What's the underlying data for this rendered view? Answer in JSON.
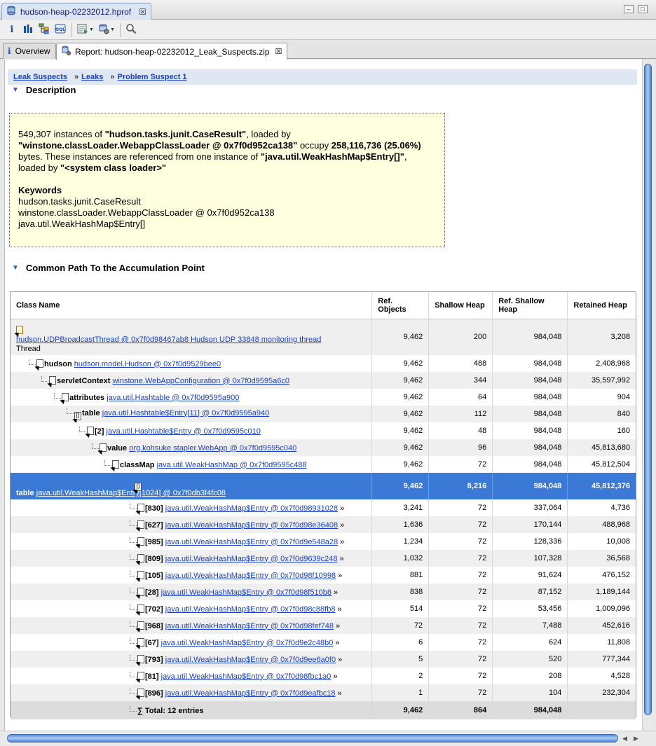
{
  "editor_tab": {
    "title": "hudson-heap-02232012.hprof"
  },
  "report_tabs": [
    {
      "label": "Overview"
    },
    {
      "label": "Report: hudson-heap-02232012_Leak_Suspects.zip"
    }
  ],
  "breadcrumb": [
    "Leak Suspects",
    "Leaks",
    "Problem Suspect 1"
  ],
  "breadcrumb_sep": "»",
  "description": {
    "title": "Description",
    "count": "549,307",
    "t1": " instances of ",
    "class_name": "\"hudson.tasks.junit.CaseResult\"",
    "t2": ", loaded by ",
    "loader": "\"winstone.classLoader.WebappClassLoader @ 0x7f0d952ca138\"",
    "t3": " occupy ",
    "size": "258,116,736 (25.06%)",
    "t4": " bytes. These instances are referenced from one instance of ",
    "ref_class": "\"java.util.WeakHashMap$Entry[]\"",
    "t5": ", loaded by ",
    "ref_loader": "\"<system class loader>\"",
    "keywords_title": "Keywords",
    "keywords": [
      "hudson.tasks.junit.CaseResult",
      "winstone.classLoader.WebappClassLoader @ 0x7f0d952ca138",
      "java.util.WeakHashMap$Entry[]"
    ]
  },
  "path_section": {
    "title": "Common Path To the Accumulation Point",
    "columns": {
      "name": "Class Name",
      "ref_objects": "Ref. Objects",
      "shallow": "Shallow Heap",
      "ref_shallow": "Ref. Shallow Heap",
      "retained": "Retained Heap"
    },
    "rows": [
      {
        "field": "",
        "link": "hudson.UDPBroadcastThread @ 0x7f0d98467ab8 Hudson UDP 33848 monitoring thread",
        "suffix": "Thread",
        "more": "",
        "ref": "9,462",
        "sh": "200",
        "rsh": "984,048",
        "ret": "3,208"
      },
      {
        "field": "hudson",
        "link": "hudson.model.Hudson @ 0x7f0d9529bee0",
        "suffix": "",
        "more": "",
        "ref": "9,462",
        "sh": "488",
        "rsh": "984,048",
        "ret": "2,408,968"
      },
      {
        "field": "servletContext",
        "link": "winstone.WebAppConfiguration @ 0x7f0d9595a6c0",
        "suffix": "",
        "more": "",
        "ref": "9,462",
        "sh": "344",
        "rsh": "984,048",
        "ret": "35,597,992"
      },
      {
        "field": "attributes",
        "link": "java.util.Hashtable @ 0x7f0d9595a900",
        "suffix": "",
        "more": "",
        "ref": "9,462",
        "sh": "64",
        "rsh": "984,048",
        "ret": "904"
      },
      {
        "field": "table",
        "link": "java.util.Hashtable$Entry[11] @ 0x7f0d9595a940",
        "suffix": "",
        "more": "",
        "ref": "9,462",
        "sh": "112",
        "rsh": "984,048",
        "ret": "840"
      },
      {
        "field": "[2]",
        "link": "java.util.Hashtable$Entry @ 0x7f0d9595c010",
        "suffix": "",
        "more": "",
        "ref": "9,462",
        "sh": "48",
        "rsh": "984,048",
        "ret": "160"
      },
      {
        "field": "value",
        "link": "org.kohsuke.stapler.WebApp @ 0x7f0d9595c040",
        "suffix": "",
        "more": "",
        "ref": "9,462",
        "sh": "96",
        "rsh": "984,048",
        "ret": "45,813,680"
      },
      {
        "field": "classMap",
        "link": "java.util.WeakHashMap @ 0x7f0d9595c488",
        "suffix": "",
        "more": "",
        "ref": "9,462",
        "sh": "72",
        "rsh": "984,048",
        "ret": "45,812,504"
      },
      {
        "field": "table",
        "link": "java.util.WeakHashMap$Entry[1024] @ 0x7f0db3f4fc08",
        "suffix": "",
        "more": "",
        "ref": "9,462",
        "sh": "8,216",
        "rsh": "984,048",
        "ret": "45,812,376"
      },
      {
        "field": "[830]",
        "link": "java.util.WeakHashMap$Entry @ 0x7f0d98931028",
        "suffix": "",
        "more": "»",
        "ref": "3,241",
        "sh": "72",
        "rsh": "337,064",
        "ret": "4,736"
      },
      {
        "field": "[627]",
        "link": "java.util.WeakHashMap$Entry @ 0x7f0d98e36408",
        "suffix": "",
        "more": "»",
        "ref": "1,636",
        "sh": "72",
        "rsh": "170,144",
        "ret": "488,968"
      },
      {
        "field": "[985]",
        "link": "java.util.WeakHashMap$Entry @ 0x7f0d9e548a28",
        "suffix": "",
        "more": "»",
        "ref": "1,234",
        "sh": "72",
        "rsh": "128,336",
        "ret": "10,008"
      },
      {
        "field": "[809]",
        "link": "java.util.WeakHashMap$Entry @ 0x7f0d9639c248",
        "suffix": "",
        "more": "»",
        "ref": "1,032",
        "sh": "72",
        "rsh": "107,328",
        "ret": "36,568"
      },
      {
        "field": "[105]",
        "link": "java.util.WeakHashMap$Entry @ 0x7f0d98f10998",
        "suffix": "",
        "more": "»",
        "ref": "881",
        "sh": "72",
        "rsh": "91,624",
        "ret": "476,152"
      },
      {
        "field": "[28]",
        "link": "java.util.WeakHashMap$Entry @ 0x7f0d98f510b8",
        "suffix": "",
        "more": "»",
        "ref": "838",
        "sh": "72",
        "rsh": "87,152",
        "ret": "1,189,144"
      },
      {
        "field": "[702]",
        "link": "java.util.WeakHashMap$Entry @ 0x7f0d98c88fb8",
        "suffix": "",
        "more": "»",
        "ref": "514",
        "sh": "72",
        "rsh": "53,456",
        "ret": "1,009,096"
      },
      {
        "field": "[968]",
        "link": "java.util.WeakHashMap$Entry @ 0x7f0d98fef748",
        "suffix": "",
        "more": "»",
        "ref": "72",
        "sh": "72",
        "rsh": "7,488",
        "ret": "452,616"
      },
      {
        "field": "[67]",
        "link": "java.util.WeakHashMap$Entry @ 0x7f0d9e2c48b0",
        "suffix": "",
        "more": "»",
        "ref": "6",
        "sh": "72",
        "rsh": "624",
        "ret": "11,808"
      },
      {
        "field": "[793]",
        "link": "java.util.WeakHashMap$Entry @ 0x7f0d9ee6a0f0",
        "suffix": "",
        "more": "»",
        "ref": "5",
        "sh": "72",
        "rsh": "520",
        "ret": "777,344"
      },
      {
        "field": "[81]",
        "link": "java.util.WeakHashMap$Entry @ 0x7f0d98fbc1a0",
        "suffix": "",
        "more": "»",
        "ref": "2",
        "sh": "72",
        "rsh": "208",
        "ret": "4,528"
      },
      {
        "field": "[896]",
        "link": "java.util.WeakHashMap$Entry @ 0x7f0d9eafbc18",
        "suffix": "",
        "more": "»",
        "ref": "1",
        "sh": "72",
        "rsh": "104",
        "ret": "232,304"
      }
    ],
    "total": {
      "label": "∑ Total: 12 entries",
      "ref": "9,462",
      "sh": "864",
      "rsh": "984,048",
      "ret": ""
    }
  },
  "icons": [
    "heap-dump-icon",
    "info-icon",
    "histogram-icon",
    "dominator-tree-icon",
    "oql-icon",
    "run-report-icon",
    "query-browser-icon",
    "search-icon",
    "close-icon",
    "collapse-triangle-icon",
    "object-node-icon"
  ]
}
